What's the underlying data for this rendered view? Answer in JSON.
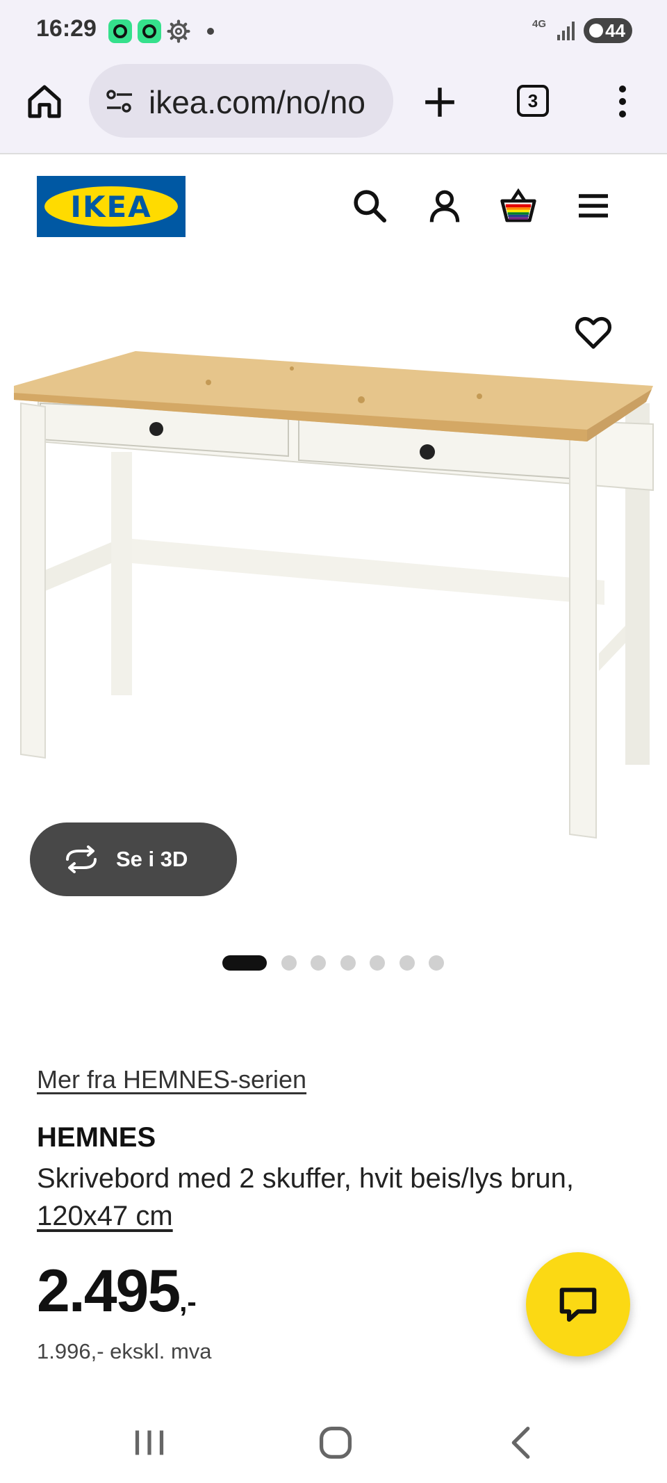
{
  "status_bar": {
    "time": "16:29",
    "network_type": "4G",
    "battery_level": "44",
    "icons": [
      "app-notification-icon",
      "app-notification-icon",
      "settings-gear-icon",
      "notification-dot",
      "signal-icon",
      "battery-icon"
    ]
  },
  "browser": {
    "url": "ikea.com/no/no",
    "tab_count": "3",
    "icons": [
      "home-icon",
      "site-settings-icon",
      "new-tab-plus-icon",
      "tabs-icon",
      "more-menu-icon"
    ]
  },
  "site_header": {
    "logo_text": "IKEA",
    "icons": [
      "search-icon",
      "account-icon",
      "cart-icon",
      "hamburger-menu-icon"
    ],
    "colors": {
      "logo_blue": "#0058a3",
      "logo_yellow": "#ffdb00"
    }
  },
  "product": {
    "view_3d_label": "Se i 3D",
    "carousel": {
      "total": 7,
      "active_index": 0
    },
    "series_link": "Mer fra HEMNES-serien",
    "name": "HEMNES",
    "description": "Skrivebord med 2 skuffer, hvit beis/lys brun,",
    "size_link": "120x47 cm",
    "price": "2.495",
    "price_suffix": ",-",
    "price_ex_vat": "1.996,- ekskl. mva"
  },
  "chat": {
    "icon": "chat-bubble-icon",
    "color": "#fbd914"
  },
  "nav_bar": {
    "icons": [
      "recent-apps-icon",
      "home-circle-icon",
      "back-icon"
    ]
  }
}
